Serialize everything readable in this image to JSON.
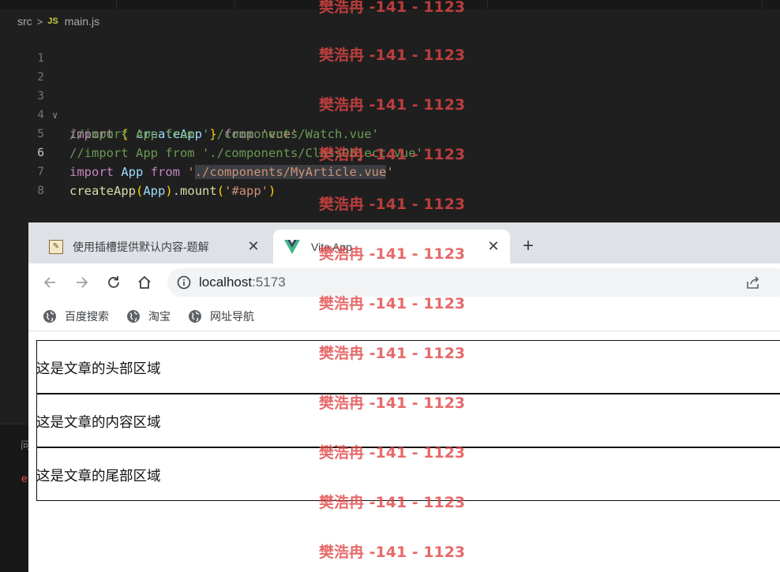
{
  "editor": {
    "breadcrumb": {
      "folder": "src",
      "separator": ">",
      "file_badge": "JS",
      "file": "main.js"
    },
    "lines": [
      {
        "num": "1"
      },
      {
        "num": "2"
      },
      {
        "num": "3",
        "tokens": [
          "import",
          "{",
          "createApp",
          "}",
          "from",
          "'vue'"
        ]
      },
      {
        "num": "4",
        "comment": "//import App from './components/Watch.vue'"
      },
      {
        "num": "5",
        "comment": "//import App from './components/ClassObject.vue'"
      },
      {
        "num": "6",
        "tokens": [
          "import",
          "App",
          "from",
          "'",
          "./components/MyArticle.vue",
          "'"
        ]
      },
      {
        "num": "7",
        "tokens": [
          "createApp",
          "(",
          "App",
          ")",
          ".",
          "mount",
          "(",
          "'#app'",
          ")"
        ]
      },
      {
        "num": "8"
      }
    ],
    "panel": {
      "tab_label": "问",
      "error_char": "e"
    }
  },
  "browser": {
    "tabs": [
      {
        "title": "使用插槽提供默认内容-题解",
        "close": "✕",
        "favicon": "image-icon"
      },
      {
        "title": "Vite App",
        "close": "✕",
        "favicon": "vue-logo-icon"
      }
    ],
    "new_tab": "+",
    "address": {
      "host": "localhost",
      "port": ":5173"
    },
    "bookmarks": [
      "百度搜索",
      "淘宝",
      "网址导航"
    ],
    "page": {
      "header": "这是文章的头部区域",
      "content": "这是文章的内容区域",
      "footer": "这是文章的尾部区域"
    }
  },
  "watermark": {
    "text": "樊浩冉 -141 - 1123",
    "color": "#e24646"
  }
}
